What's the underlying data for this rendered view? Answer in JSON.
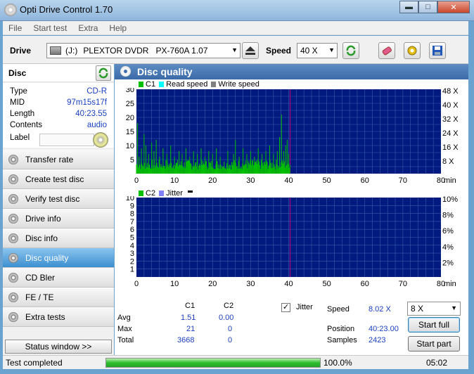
{
  "window": {
    "title": "Opti Drive Control 1.70",
    "min_label": "▬",
    "max_label": "□",
    "close_label": "✕"
  },
  "menu": [
    "File",
    "Start test",
    "Extra",
    "Help"
  ],
  "toolbar": {
    "drive_label": "Drive",
    "drive_letter": "(J:)",
    "drive_name": "PLEXTOR DVDR   PX-760A 1.07",
    "speed_label": "Speed",
    "speed_value": "40 X"
  },
  "disc": {
    "header": "Disc",
    "rows": [
      {
        "key": "Type",
        "value": "CD-R"
      },
      {
        "key": "MID",
        "value": "97m15s17f"
      },
      {
        "key": "Length",
        "value": "40:23.55"
      },
      {
        "key": "Contents",
        "value": "audio"
      }
    ],
    "label_key": "Label"
  },
  "nav": [
    {
      "label": "Transfer rate",
      "active": false
    },
    {
      "label": "Create test disc",
      "active": false
    },
    {
      "label": "Verify test disc",
      "active": false
    },
    {
      "label": "Drive info",
      "active": false
    },
    {
      "label": "Disc info",
      "active": false
    },
    {
      "label": "Disc quality",
      "active": true
    },
    {
      "label": "CD Bler",
      "active": false
    },
    {
      "label": "FE / TE",
      "active": false
    },
    {
      "label": "Extra tests",
      "active": false
    }
  ],
  "status_window_label": "Status window >>",
  "panel_title": "Disc quality",
  "legend_top": {
    "c1": "C1",
    "read": "Read speed",
    "write": "Write speed"
  },
  "legend_bottom": {
    "c2": "C2",
    "jitter": "Jitter"
  },
  "colors": {
    "c1": "#00c000",
    "read": "#00ffff",
    "write": "#808080",
    "plot_bg": "#001a80",
    "grid": "#3a5aa8",
    "jitter": "#8080ff",
    "marker": "#c00080"
  },
  "chart_data": [
    {
      "type": "bar",
      "title": "",
      "series": [
        {
          "name": "C1",
          "summary": {
            "avg": 1.51,
            "max": 21,
            "total": 3668
          }
        }
      ],
      "x_ticks": [
        0,
        10,
        20,
        30,
        40,
        50,
        60,
        70,
        80
      ],
      "x_unit": "min",
      "xlim": [
        0,
        80
      ],
      "y_ticks": [
        5,
        10,
        15,
        20,
        25,
        30
      ],
      "ylim": [
        0,
        30
      ],
      "y2_ticks": [
        "48 X",
        "40 X",
        "32 X",
        "24 X",
        "16 X",
        "8 X"
      ],
      "data_end_min": 40.38,
      "spikes": [
        [
          0.3,
          18
        ],
        [
          0.7,
          6
        ],
        [
          1.3,
          9
        ],
        [
          2.0,
          14
        ],
        [
          2.5,
          10
        ],
        [
          3.2,
          7
        ],
        [
          4.0,
          11
        ],
        [
          4.6,
          8
        ],
        [
          5.2,
          12
        ],
        [
          6.1,
          6
        ],
        [
          7.0,
          9
        ],
        [
          8.0,
          7
        ],
        [
          9.0,
          10
        ],
        [
          10.0,
          6
        ],
        [
          11.2,
          8
        ],
        [
          12.0,
          7
        ],
        [
          13.0,
          9
        ],
        [
          14.0,
          6
        ],
        [
          15.0,
          8
        ],
        [
          16.0,
          7
        ],
        [
          17.0,
          9
        ],
        [
          18.0,
          6
        ],
        [
          19.0,
          8
        ],
        [
          20.0,
          7
        ],
        [
          21.0,
          9
        ],
        [
          22.0,
          6
        ],
        [
          24.0,
          8
        ],
        [
          25.5,
          7
        ],
        [
          26.0,
          12
        ],
        [
          27.0,
          6
        ],
        [
          28.0,
          9
        ],
        [
          29.0,
          7
        ],
        [
          30.0,
          8
        ],
        [
          31.0,
          6
        ],
        [
          32.0,
          9
        ],
        [
          33.0,
          7
        ],
        [
          34.0,
          8
        ],
        [
          35.0,
          10
        ],
        [
          36.0,
          7
        ],
        [
          37.0,
          8
        ],
        [
          37.6,
          13
        ],
        [
          38.1,
          21
        ],
        [
          38.7,
          8
        ],
        [
          39.2,
          10
        ],
        [
          39.6,
          12
        ],
        [
          40.0,
          7
        ]
      ]
    },
    {
      "type": "bar",
      "title": "",
      "series": [
        {
          "name": "C2",
          "summary": {
            "avg": 0.0,
            "max": 0,
            "total": 0
          }
        }
      ],
      "x_ticks": [
        0,
        10,
        20,
        30,
        40,
        50,
        60,
        70,
        80
      ],
      "x_unit": "min",
      "xlim": [
        0,
        80
      ],
      "y_ticks": [
        1,
        2,
        3,
        4,
        5,
        6,
        7,
        8,
        9,
        10
      ],
      "ylim": [
        0,
        10
      ],
      "y2_ticks": [
        "10%",
        "8%",
        "6%",
        "4%",
        "2%"
      ],
      "data_end_min": 40.38
    }
  ],
  "stats": {
    "col_c1": "C1",
    "col_c2": "C2",
    "rows": [
      {
        "label": "Avg",
        "c1": "1.51",
        "c2": "0.00"
      },
      {
        "label": "Max",
        "c1": "21",
        "c2": "0"
      },
      {
        "label": "Total",
        "c1": "3668",
        "c2": "0"
      }
    ],
    "jitter_label": "Jitter",
    "jitter_checked": "✓",
    "speed_label": "Speed",
    "speed_value": "8.02 X",
    "position_label": "Position",
    "position_value": "40:23.00",
    "samples_label": "Samples",
    "samples_value": "2423",
    "speed_select": "8 X",
    "start_full": "Start full",
    "start_part": "Start part"
  },
  "status": {
    "text": "Test completed",
    "progress_pct": "100.0%",
    "progress": 1.0,
    "time": "05:02"
  }
}
